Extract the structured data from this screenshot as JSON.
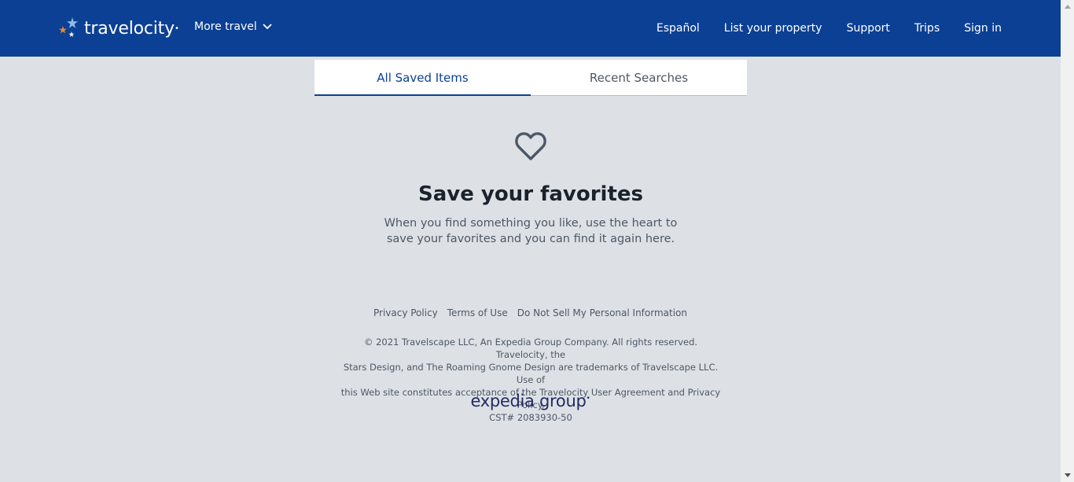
{
  "header": {
    "logo_text": "travelocity",
    "more_travel": "More travel",
    "nav": [
      "Español",
      "List your property",
      "Support",
      "Trips",
      "Sign in"
    ]
  },
  "tabs": [
    "All Saved Items",
    "Recent Searches"
  ],
  "empty_state": {
    "title": "Save your favorites",
    "description": "When you find something you like, use the heart to save your favorites and you can find it again here."
  },
  "footer": {
    "links": [
      "Privacy Policy",
      "Terms of Use",
      "Do Not Sell My Personal Information"
    ],
    "legal_lines": [
      "© 2021 Travelscape LLC, An Expedia Group Company. All rights reserved. Travelocity, the",
      "Stars Design, and The Roaming Gnome Design are trademarks of Travelscape LLC. Use of",
      "this Web site constitutes acceptance of the Travelocity User Agreement and Privacy Policy.",
      "CST# 2083930-50"
    ],
    "brand": "expedia group"
  },
  "colors": {
    "header_bg": "#0b4094",
    "page_bg": "#dde1e5",
    "accent": "#0b4094",
    "brand": "#242a63"
  }
}
